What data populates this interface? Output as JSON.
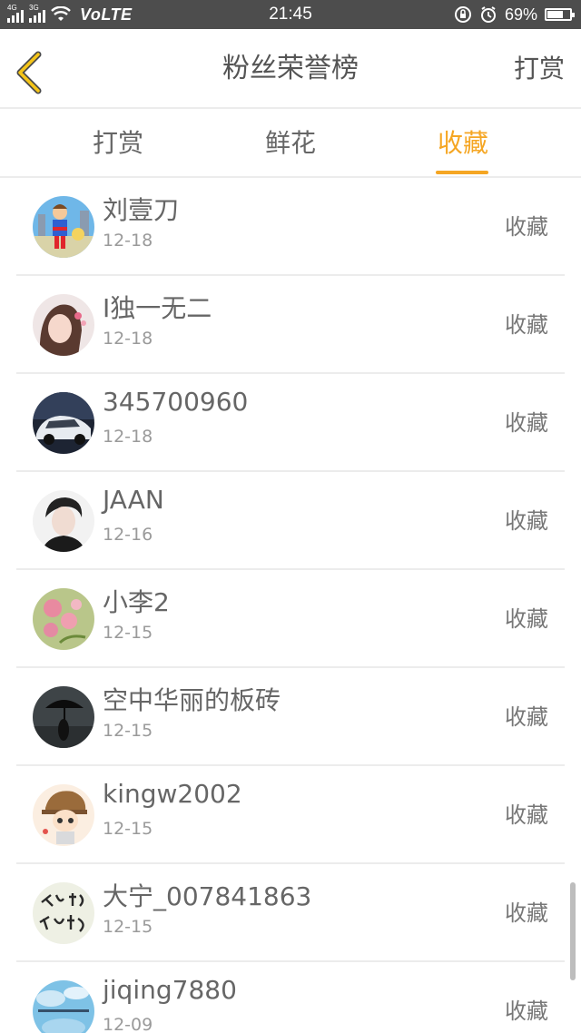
{
  "status_bar": {
    "network_left": "4G",
    "network_right": "3G",
    "volte": "VoLTE",
    "time": "21:45",
    "battery": "69%",
    "battery_level": 0.69
  },
  "header": {
    "title": "粉丝荣誉榜",
    "right_action": "打赏"
  },
  "tabs": [
    {
      "label": "打赏",
      "active": false
    },
    {
      "label": "鲜花",
      "active": false
    },
    {
      "label": "收藏",
      "active": true
    }
  ],
  "list": [
    {
      "name": "刘壹刀",
      "date": "12-18",
      "action": "收藏"
    },
    {
      "name": "I独一无二",
      "date": "12-18",
      "action": "收藏"
    },
    {
      "name": "345700960",
      "date": "12-18",
      "action": "收藏"
    },
    {
      "name": "JAAN",
      "date": "12-16",
      "action": "收藏"
    },
    {
      "name": "小李2",
      "date": "12-15",
      "action": "收藏"
    },
    {
      "name": "空中华丽的板砖",
      "date": "12-15",
      "action": "收藏"
    },
    {
      "name": "kingw2002",
      "date": "12-15",
      "action": "收藏"
    },
    {
      "name": "大宁_007841863",
      "date": "12-15",
      "action": "收藏"
    },
    {
      "name": "jiqing7880",
      "date": "12-09",
      "action": "收藏"
    }
  ],
  "colors": {
    "accent": "#f5a623",
    "status_bar_bg": "#4d4d4d",
    "divider": "#ececec"
  }
}
